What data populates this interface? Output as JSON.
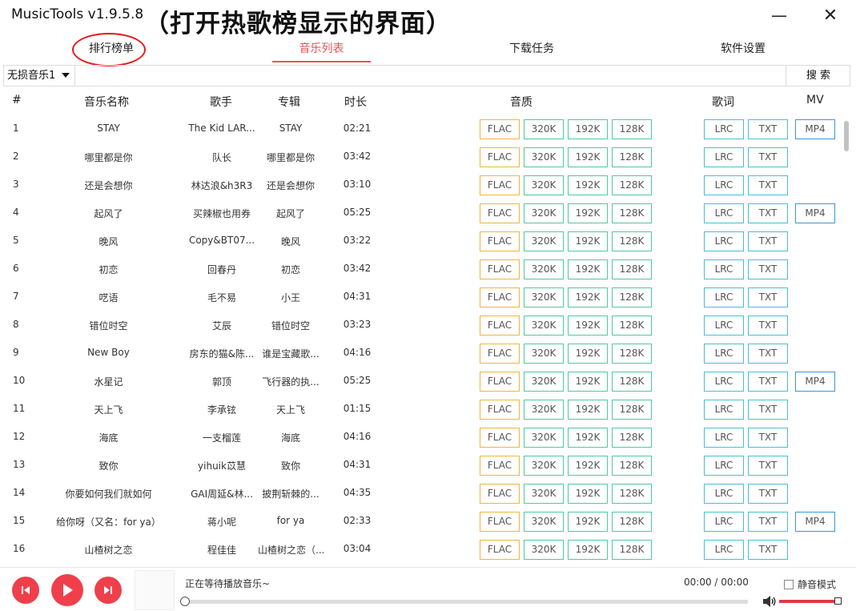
{
  "window": {
    "title": "MusicTools v1.9.5.8",
    "annotation": "（打开热歌榜显示的界面）",
    "minimize_glyph": "—",
    "close_glyph": "✕"
  },
  "nav": {
    "tabs": [
      {
        "label": "排行榜单"
      },
      {
        "label": "音乐列表"
      },
      {
        "label": "下载任务"
      },
      {
        "label": "软件设置"
      }
    ],
    "active": "音乐列表"
  },
  "search": {
    "source_selected": "无损音乐1",
    "query": "",
    "button_label": "搜 索"
  },
  "table": {
    "columns": {
      "num": "#",
      "name": "音乐名称",
      "artist": "歌手",
      "album": "专辑",
      "duration": "时长",
      "quality": "音质",
      "lyrics": "歌词",
      "mv": "MV"
    },
    "quality_labels": [
      "FLAC",
      "320K",
      "192K",
      "128K"
    ],
    "lyric_labels": [
      "LRC",
      "TXT"
    ],
    "mv_label": "MP4",
    "rows": [
      {
        "num": "1",
        "name": "STAY",
        "artist": "The Kid LAR...",
        "album": "STAY",
        "duration": "02:21",
        "mv": true
      },
      {
        "num": "2",
        "name": "哪里都是你",
        "artist": "队长",
        "album": "哪里都是你",
        "duration": "03:42",
        "mv": false
      },
      {
        "num": "3",
        "name": "还是会想你",
        "artist": "林达浪&h3R3",
        "album": "还是会想你",
        "duration": "03:10",
        "mv": false
      },
      {
        "num": "4",
        "name": "起风了",
        "artist": "买辣椒也用券",
        "album": "起风了",
        "duration": "05:25",
        "mv": true
      },
      {
        "num": "5",
        "name": "晚风",
        "artist": "Copy&BT07...",
        "album": "晚风",
        "duration": "03:22",
        "mv": false
      },
      {
        "num": "6",
        "name": "初恋",
        "artist": "回春丹",
        "album": "初恋",
        "duration": "03:42",
        "mv": false
      },
      {
        "num": "7",
        "name": "呓语",
        "artist": "毛不易",
        "album": "小王",
        "duration": "04:31",
        "mv": false
      },
      {
        "num": "8",
        "name": "错位时空",
        "artist": "艾辰",
        "album": "错位时空",
        "duration": "03:23",
        "mv": false
      },
      {
        "num": "9",
        "name": "New Boy",
        "artist": "房东的猫&陈...",
        "album": "谁是宝藏歌...",
        "duration": "04:16",
        "mv": false
      },
      {
        "num": "10",
        "name": "水星记",
        "artist": "郭顶",
        "album": "飞行器的执...",
        "duration": "05:25",
        "mv": true
      },
      {
        "num": "11",
        "name": "天上飞",
        "artist": "李承铉",
        "album": "天上飞",
        "duration": "01:15",
        "mv": false
      },
      {
        "num": "12",
        "name": "海底",
        "artist": "一支榴莲",
        "album": "海底",
        "duration": "04:16",
        "mv": false
      },
      {
        "num": "13",
        "name": "致你",
        "artist": "yihuik苡慧",
        "album": "致你",
        "duration": "04:31",
        "mv": false
      },
      {
        "num": "14",
        "name": "你要如何我们就如何",
        "artist": "GAI周延&林...",
        "album": "披荆斩棘的...",
        "duration": "04:35",
        "mv": false
      },
      {
        "num": "15",
        "name": "给你呀（又名：for ya）",
        "artist": "蒋小呢",
        "album": "for ya",
        "duration": "02:33",
        "mv": true
      },
      {
        "num": "16",
        "name": "山楂树之恋",
        "artist": "程佳佳",
        "album": "山楂树之恋（...",
        "duration": "03:04",
        "mv": false
      }
    ]
  },
  "player": {
    "status": "正在等待播放音乐~",
    "time": "00:00 / 00:00",
    "mute_label": "静音模式",
    "mute_checked": false,
    "progress_fraction": 0.0,
    "volume_fraction": 1.0,
    "accent_color": "#ef3f4a"
  },
  "colors": {
    "active_tab": "#ef4e58",
    "flac_border": "#f2b53a",
    "bitrate_border": "#4ec9a2",
    "lyric_border": "#45c0d6",
    "mv_border": "#3b96d8",
    "annotation_circle": "#e31c1c"
  },
  "icons": {
    "prev": "skip-previous-icon",
    "play": "play-icon",
    "next": "skip-next-icon",
    "volume": "speaker-icon",
    "dropdown": "caret-down-icon"
  }
}
